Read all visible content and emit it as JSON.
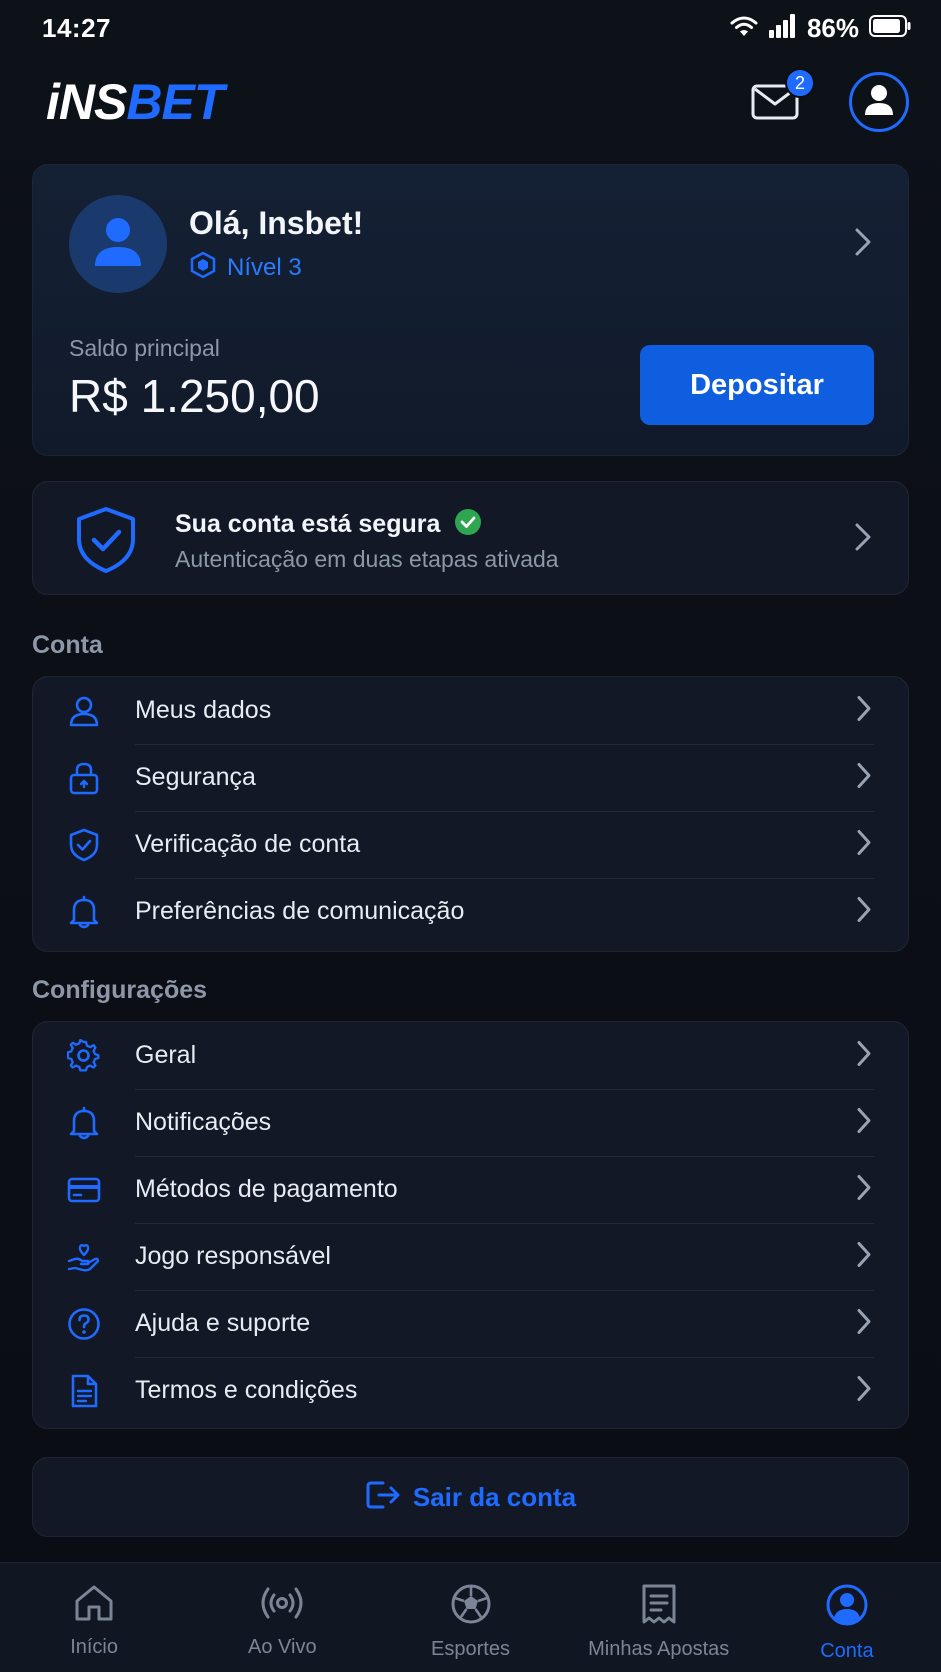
{
  "status_bar": {
    "time": "14:27",
    "battery_pct": "86%"
  },
  "header": {
    "logo_part1": "iNS",
    "logo_part2": "BET",
    "mail_badge": "2"
  },
  "profile": {
    "greeting": "Olá, Insbet!",
    "level": "Nível 3",
    "balance_label": "Saldo principal",
    "balance_value": "R$ 1.250,00",
    "deposit_label": "Depositar"
  },
  "security": {
    "title": "Sua conta está segura",
    "subtitle": "Autenticação em duas etapas ativada"
  },
  "account_section": {
    "title": "Conta",
    "items": [
      {
        "label": "Meus dados",
        "icon": "user-icon"
      },
      {
        "label": "Segurança",
        "icon": "lock-icon"
      },
      {
        "label": "Verificação de conta",
        "icon": "shield-check-icon"
      },
      {
        "label": "Preferências de comunicação",
        "icon": "bell-icon"
      }
    ]
  },
  "settings_section": {
    "title": "Configurações",
    "items": [
      {
        "label": "Geral",
        "icon": "gear-icon"
      },
      {
        "label": "Notificações",
        "icon": "bell-icon"
      },
      {
        "label": "Métodos de pagamento",
        "icon": "credit-card-icon"
      },
      {
        "label": "Jogo responsável",
        "icon": "heart-hand-icon"
      },
      {
        "label": "Ajuda e suporte",
        "icon": "help-icon"
      },
      {
        "label": "Termos e condições",
        "icon": "document-icon"
      }
    ]
  },
  "logout": {
    "label": "Sair da conta"
  },
  "bottom_nav": {
    "items": [
      {
        "label": "Início",
        "icon": "home-icon"
      },
      {
        "label": "Ao Vivo",
        "icon": "live-icon"
      },
      {
        "label": "Esportes",
        "icon": "soccer-ball-icon"
      },
      {
        "label": "Minhas Apostas",
        "icon": "bets-icon"
      },
      {
        "label": "Conta",
        "icon": "account-icon"
      }
    ],
    "active_index": 4
  },
  "colors": {
    "accent": "#1f6bff",
    "deposit": "#0f5ee0",
    "success": "#2ea54f",
    "background": "#0b0e14",
    "card": "#121826"
  }
}
